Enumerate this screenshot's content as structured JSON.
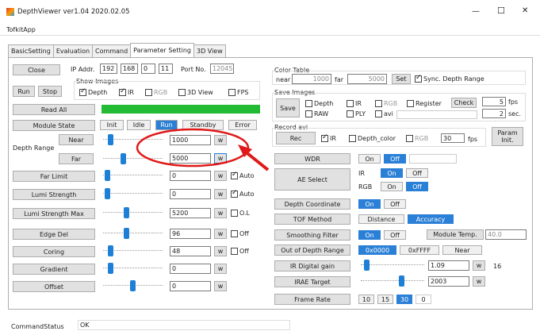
{
  "window": {
    "title": "DepthViewer ver1.04 2020.02.05",
    "minimize": "—",
    "maximize": "☐",
    "close": "✕"
  },
  "menu": {
    "app": "TofkitApp"
  },
  "tabs": [
    "BasicSetting",
    "Evaluation",
    "Command",
    "Parameter Setting",
    "3D View"
  ],
  "left": {
    "close": "Close",
    "ip_label": "IP Addr.",
    "ip": [
      "192",
      "168",
      "0",
      "11"
    ],
    "port_label": "Port No.",
    "port": "12045",
    "show_images": "Show Images",
    "run": "Run",
    "stop": "Stop",
    "checks": [
      "Depth",
      "IR",
      "RGB",
      "3D View",
      "FPS"
    ],
    "read_all": "Read All",
    "module_state": "Module State",
    "states": [
      "Init",
      "Idle",
      "Run",
      "Standby",
      "Error"
    ],
    "depth_range": "Depth Range",
    "near": "Near",
    "far": "Far",
    "near_value": "1000",
    "far_value": "5000",
    "w": "w",
    "rows": [
      {
        "label": "Far Limit",
        "value": "0",
        "check": "Auto"
      },
      {
        "label": "Lumi Strength",
        "value": "0",
        "check": "Auto"
      },
      {
        "label": "Lumi Strength Max",
        "value": "5200",
        "check": "O.L"
      },
      {
        "label": "Edge Del",
        "value": "96",
        "check": "Off"
      },
      {
        "label": "Coring",
        "value": "48",
        "check": "Off"
      },
      {
        "label": "Gradient",
        "value": "0",
        "check": ""
      },
      {
        "label": "Offset",
        "value": "0",
        "check": ""
      }
    ]
  },
  "right": {
    "color_table": "Color Table",
    "near": "near",
    "near_value": "1000",
    "far": "far",
    "far_value": "5000",
    "set": "Set",
    "sync": "Sync. Depth Range",
    "save_images": "Save Images",
    "save": "Save",
    "save_checks": [
      "Depth",
      "IR",
      "RGB",
      "Register",
      "RAW",
      "PLY",
      "avi"
    ],
    "check": "Check",
    "fps_value": "5",
    "fps": "fps",
    "sec_value": "2",
    "sec": "sec.",
    "record_avi": "Record avi",
    "rec": "Rec",
    "rec_checks": [
      "IR",
      "Depth_color",
      "RGB"
    ],
    "rec_fps_value": "30",
    "rec_fps": "fps",
    "param_init": "Param Init.",
    "wdr": "WDR",
    "on": "On",
    "off": "Off",
    "ae_select": "AE Select",
    "ir": "IR",
    "rgb": "RGB",
    "depth_coord": "Depth Coordinate",
    "tof_method": "TOF Method",
    "distance": "Distance",
    "accuracy": "Accuracy",
    "smoothing": "Smoothing Filter",
    "module_temp": "Module Temp.",
    "module_temp_value": "40.0",
    "out_of_depth": "Out of Depth Range",
    "ood_opts": [
      "0x0000",
      "0xFFFF",
      "Near"
    ],
    "ir_gain": "IR Digital gain",
    "ir_gain_value": "1.09",
    "ir_gain_max": "16",
    "irae": "IRAE Target",
    "irae_value": "2003",
    "frame_rate": "Frame Rate",
    "fr_opts": [
      "10",
      "15",
      "30",
      "0"
    ]
  },
  "status": {
    "label": "CommandStatus",
    "value": "OK"
  }
}
